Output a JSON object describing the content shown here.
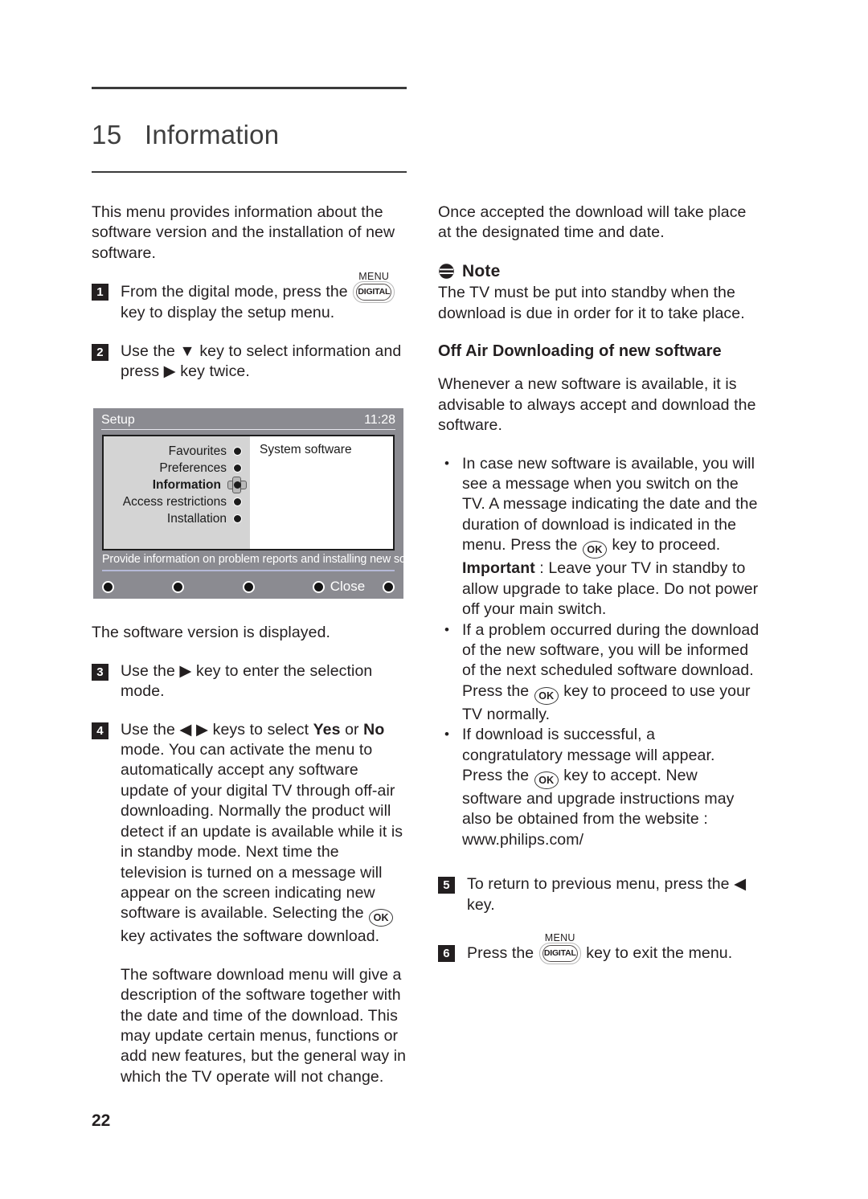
{
  "chapter": {
    "number": "15",
    "title": "Information"
  },
  "page_number": "22",
  "left_column": {
    "intro": "This menu provides information about the software version and the installation of new software.",
    "step1": {
      "num": "1",
      "text_before": "From the digital mode, press the",
      "key_menu_label": "MENU",
      "key_label": "DIGITAL",
      "text_after": "key to display the setup menu."
    },
    "step2": {
      "num": "2",
      "text": "Use the ▼ key to select information and press ▶ key twice."
    },
    "caption_after_osd": "The software version is displayed.",
    "step3": {
      "num": "3",
      "text": "Use the ▶ key to enter the selection mode."
    },
    "step4": {
      "num": "4",
      "part1": "Use the ◀  ▶ keys to select ",
      "bold_yes": "Yes",
      "part2": " or ",
      "bold_no": "No",
      "part3": " mode. You can activate the menu to automatically accept any software update of your digital TV through off-air downloading. Normally the product will detect if an update is available while it is in standby mode. Next time the television is turned on a message will appear on the screen indicating new software is available. Selecting the ",
      "ok_key": "OK",
      "part4": " key activates the software download."
    },
    "closing_paragraph": "The software download menu will give a description of the software together with the date and time of the download. This may update certain menus, functions or add new features, but the general way in which the TV operate will not change."
  },
  "osd": {
    "title": "Setup",
    "clock": "11:28",
    "menu_items": [
      {
        "label": "Favourites",
        "selected": false
      },
      {
        "label": "Preferences",
        "selected": false
      },
      {
        "label": "Information",
        "selected": true
      },
      {
        "label": "Access restrictions",
        "selected": false
      },
      {
        "label": "Installation",
        "selected": false
      }
    ],
    "pane_text": "System software",
    "help_text": "Provide information on problem reports and installing new software",
    "footer_label": "Close",
    "colors": {
      "background": "#8b8b91",
      "menu_panel": "#d4d4d4",
      "pane": "#ffffff",
      "border": "#1d1d1d",
      "separator": "#b6b9d8",
      "text_on_grey": "#ffffff"
    }
  },
  "right_column": {
    "intro": "Once accepted the download will take place at the designated time and date.",
    "note": {
      "icon": "note-icon",
      "title": "Note",
      "text": "The TV must be put into standby when the download is due in order for it to take place."
    },
    "subheading": "Off Air Downloading of new software",
    "lead": "Whenever a new software is available, it is advisable to always accept and download the software.",
    "bullets": [
      {
        "part1": "In case new software is available, you will see a message when you switch on the TV. A message indicating the date and the duration of download is indicated in the menu. Press the ",
        "ok_key": "OK",
        "part2": " key to proceed. ",
        "bold": "Important",
        "part3": " : Leave your TV in standby to allow upgrade to take place. Do not power off your main switch."
      },
      {
        "part1": "If a problem occurred during the download of the new software, you will be informed of the next scheduled software download. Press the ",
        "ok_key": "OK",
        "part2": " key to proceed to use your TV normally."
      },
      {
        "part1": "If download is successful, a congratulatory message will appear. Press the ",
        "ok_key": "OK",
        "part2": " key to accept. New software and upgrade instructions may also be obtained from the website : www.philips.com/"
      }
    ],
    "step5": {
      "num": "5",
      "text": "To return to previous menu, press the ◀ key."
    },
    "step6": {
      "num": "6",
      "text_before": "Press the",
      "key_menu_label": "MENU",
      "key_label": "DIGITAL",
      "text_after": "key to exit the menu."
    }
  }
}
